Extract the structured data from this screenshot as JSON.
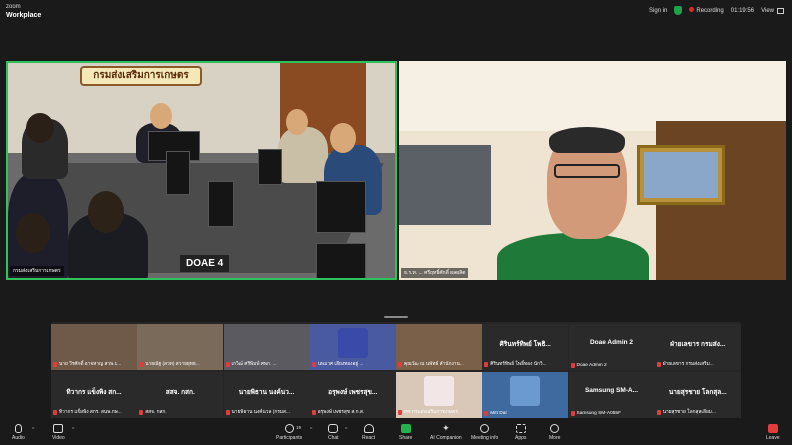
{
  "app": {
    "brand_line1": "zoom",
    "brand_line2": "Workplace"
  },
  "topbar": {
    "sign_in": "Sign in",
    "recording_label": "Recording",
    "recording_time": "01:19:56",
    "view": "View"
  },
  "main_tiles": {
    "left": {
      "name": "กรมส่งเสริมการเกษตร",
      "room_sign": "กรมส่งเสริมการเกษตร",
      "door_label": "DOAE 4"
    },
    "right": {
      "name": "ธ.ร.ท. ... ศรีฤทธิ์ศักดิ์ ผลผลิต"
    }
  },
  "gallery": {
    "cells": [
      {
        "type": "video",
        "label": "นาย วีรศักดิ์ อาจหาญ สวพ.1..."
      },
      {
        "type": "video",
        "label": "นายณัฐ (สวท) สวายยุทธ..."
      },
      {
        "type": "video",
        "label": "เกวิฒ์ ศรีพิมพ์ ศพก. ..."
      },
      {
        "type": "video",
        "label": "นพมาศ เอียงทองอยู่ ..."
      },
      {
        "type": "video",
        "label": "คุณวัฒ ณ นพัทธ์ สำนักงาน..."
      },
      {
        "type": "name",
        "title": "ศิรินทร์ทิพย์ โพธิ...",
        "label": "ศิรินทร์ทิพย์ โพธิ์ทอง นักวิ..."
      },
      {
        "type": "name",
        "title": "Doae Admin 2",
        "label": "Doae Admin 2"
      },
      {
        "type": "name",
        "title": "ฝ่ายเลขาร กรมส่ง...",
        "label": "ฝ่ายเลขาร กรมส่งเสริม..."
      },
      {
        "type": "name",
        "title": "ทิวากร แข็งพิง สก...",
        "label": "ทิวากร แข็งพิง สกร. สนพ.กษ..."
      },
      {
        "type": "name",
        "title": "สสจ. กสก.",
        "label": "สสจ. กสก."
      },
      {
        "type": "name",
        "title": "นายพิธาน นงค์นว...",
        "label": "นายพิธาน นงค์นวล (กรมส..."
      },
      {
        "type": "name",
        "title": "อรุพงษ์ เพชรสุข...",
        "label": "อรุพงษ์ เพชรสุข ส.ก.ส."
      },
      {
        "type": "video",
        "label": "PR กรมส่งเสริมการเกษตร"
      },
      {
        "type": "video",
        "label": "Mitt Dal"
      },
      {
        "type": "name",
        "title": "Samsung SM-A...",
        "label": "Samsung SM-A055F"
      },
      {
        "type": "name",
        "title": "นายสุรชาย โลกสุล...",
        "label": "นายสุรชาย โลกสุลเลียม..."
      }
    ]
  },
  "toolbar": {
    "audio": "Audio",
    "video": "Video",
    "participants": "Participants",
    "participants_count": "19",
    "chat": "Chat",
    "react": "React",
    "share": "Share",
    "ai_companion": "AI Companion",
    "meeting_info": "Meeting info",
    "apps": "Apps",
    "more": "More",
    "leave": "Leave"
  },
  "colors": {
    "active_speaker": "#2fc15b",
    "recording": "#e02828",
    "share": "#22b14c",
    "leave": "#e23c3c"
  }
}
